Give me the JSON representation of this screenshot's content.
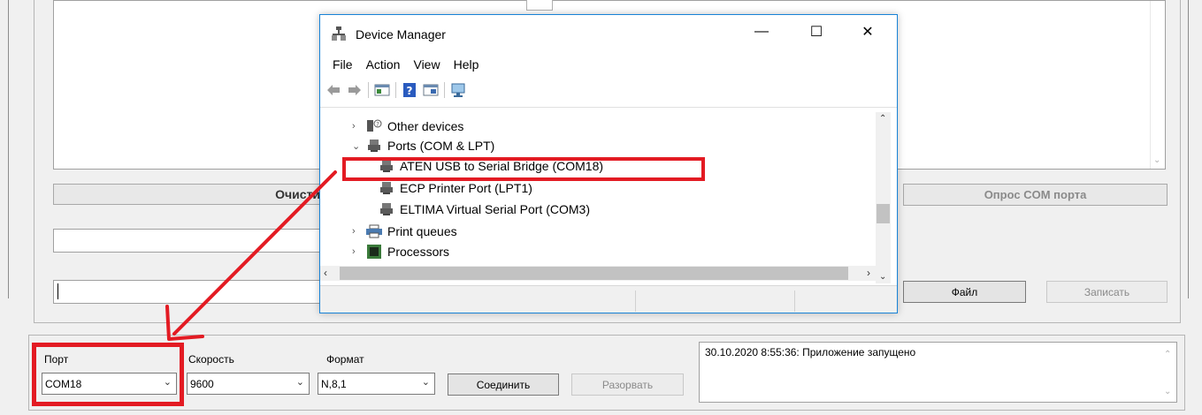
{
  "background_app": {
    "clear_button_label": "Очисти",
    "poll_com_button_label": "Опрос COM порта",
    "file_button_label": "Файл",
    "write_button_label": "Записать",
    "connection": {
      "port_label": "Порт",
      "port_value": "COM18",
      "speed_label": "Скорость",
      "speed_value": "9600",
      "format_label": "Формат",
      "format_value": "N,8,1",
      "connect_button_label": "Соединить",
      "disconnect_button_label": "Разорвать"
    },
    "status_log": "30.10.2020 8:55:36:  Приложение запущено"
  },
  "device_manager": {
    "title": "Device Manager",
    "window_controls": {
      "minimize": "—",
      "maximize": "☐",
      "close": "✕"
    },
    "menu": [
      "File",
      "Action",
      "View",
      "Help"
    ],
    "toolbar_icons": [
      "back-icon",
      "forward-icon",
      "properties-icon",
      "help-icon",
      "update-driver-icon",
      "monitor-icon"
    ],
    "tree": [
      {
        "label": "Other devices",
        "expander": "›",
        "icon": "unknown-device-icon"
      },
      {
        "label": "Ports (COM & LPT)",
        "expander": "⌄",
        "icon": "port-icon"
      },
      {
        "label": "ATEN USB to Serial Bridge (COM18)",
        "expander": "",
        "icon": "port-icon"
      },
      {
        "label": "ECP Printer Port (LPT1)",
        "expander": "",
        "icon": "port-icon"
      },
      {
        "label": "ELTIMA Virtual Serial Port (COM3)",
        "expander": "",
        "icon": "port-icon"
      },
      {
        "label": "Print queues",
        "expander": "›",
        "icon": "printer-icon"
      },
      {
        "label": "Processors",
        "expander": "›",
        "icon": "processor-icon"
      }
    ]
  },
  "annotations": {
    "highlight_color": "#e31b23"
  }
}
